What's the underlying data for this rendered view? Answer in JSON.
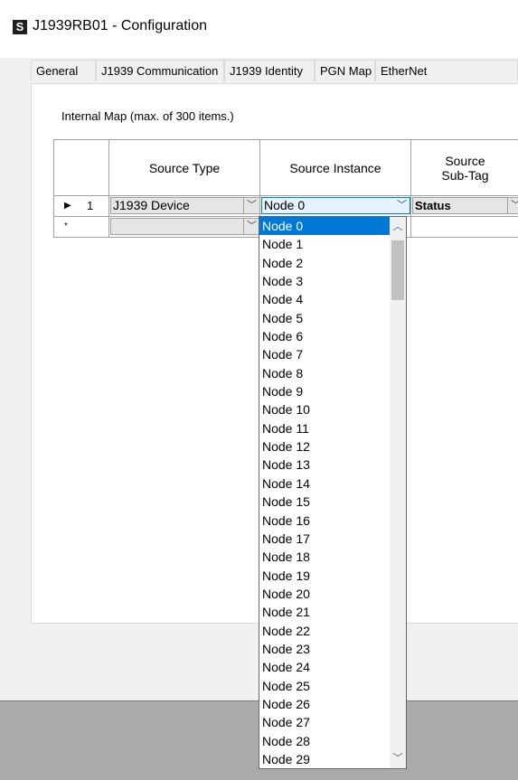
{
  "window": {
    "title": "J1939RB01 - Configuration",
    "app_icon_glyph": "S"
  },
  "tabs": [
    {
      "label": "General"
    },
    {
      "label": "J1939 Communication"
    },
    {
      "label": "J1939 Identity"
    },
    {
      "label": "PGN Map"
    },
    {
      "label": "EtherNet"
    }
  ],
  "panel": {
    "label": "Internal Map (max. of 300 items.)"
  },
  "grid": {
    "columns": [
      "Source Type",
      "Source Instance",
      "Source Sub-Tag"
    ],
    "rows": [
      {
        "marker": "▶",
        "number": "1",
        "source_type": "J1939 Device",
        "source_instance": "Node 0",
        "source_subtag": "Status"
      },
      {
        "marker": "*",
        "number": "",
        "source_type": "",
        "source_instance": "",
        "source_subtag": ""
      }
    ]
  },
  "dropdown": {
    "selected": "Node 0",
    "options": [
      "Node 0",
      "Node 1",
      "Node 2",
      "Node 3",
      "Node 4",
      "Node 5",
      "Node 6",
      "Node 7",
      "Node 8",
      "Node 9",
      "Node 10",
      "Node 11",
      "Node 12",
      "Node 13",
      "Node 14",
      "Node 15",
      "Node 16",
      "Node 17",
      "Node 18",
      "Node 19",
      "Node 20",
      "Node 21",
      "Node 22",
      "Node 23",
      "Node 24",
      "Node 25",
      "Node 26",
      "Node 27",
      "Node 28",
      "Node 29"
    ]
  },
  "icons": {
    "combo_arrow": "chevron-down-icon",
    "scroll_up": "chevron-up-icon",
    "scroll_down": "chevron-down-icon"
  },
  "colors": {
    "selection": "#0078d7",
    "focus_combo": "#e5f1fb"
  }
}
